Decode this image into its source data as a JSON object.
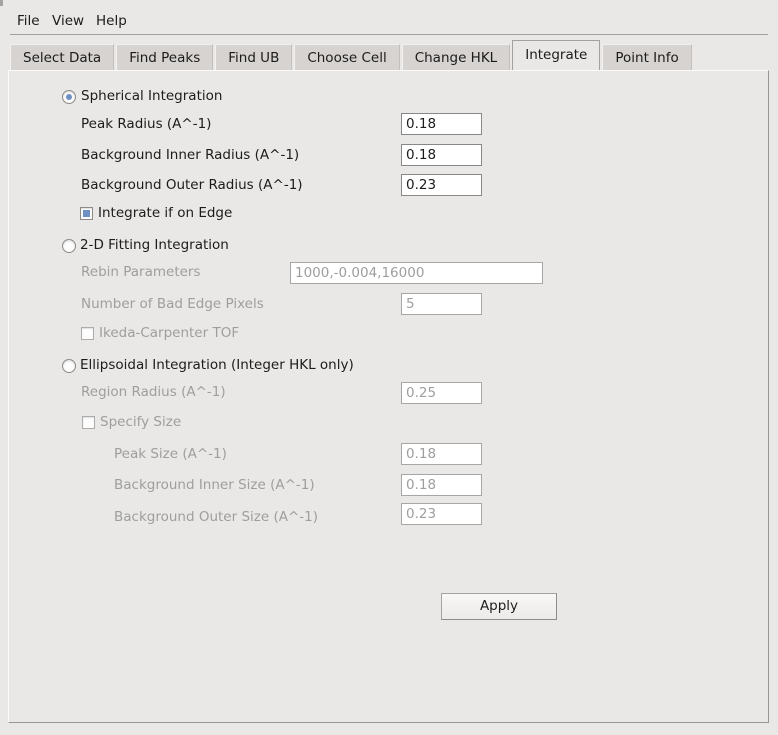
{
  "menu": {
    "items": [
      {
        "label": "File"
      },
      {
        "label": "View"
      },
      {
        "label": "Help"
      }
    ]
  },
  "tabs": {
    "items": [
      {
        "label": "Select Data",
        "selected": false
      },
      {
        "label": "Find Peaks",
        "selected": false
      },
      {
        "label": "Find UB",
        "selected": false
      },
      {
        "label": "Choose Cell",
        "selected": false
      },
      {
        "label": "Change HKL",
        "selected": false
      },
      {
        "label": "Integrate",
        "selected": true
      },
      {
        "label": "Point Info",
        "selected": false
      }
    ]
  },
  "panel": {
    "spherical": {
      "label": "Spherical Integration",
      "selected": true,
      "peak_radius": {
        "label": "Peak Radius (A^-1)",
        "value": "0.18"
      },
      "bg_inner_radius": {
        "label": "Background Inner Radius (A^-1)",
        "value": "0.18"
      },
      "bg_outer_radius": {
        "label": "Background Outer Radius (A^-1)",
        "value": "0.23"
      },
      "edge": {
        "label": "Integrate if on Edge",
        "checked": true
      }
    },
    "fit2d": {
      "label": "2-D Fitting Integration",
      "selected": false,
      "rebin": {
        "label": "Rebin Parameters",
        "value": "1000,-0.004,16000"
      },
      "bad_edge": {
        "label": "Number of Bad Edge Pixels",
        "value": "5"
      },
      "ikeda": {
        "label": "Ikeda-Carpenter TOF",
        "checked": false
      }
    },
    "ellipsoidal": {
      "label": "Ellipsoidal Integration (Integer HKL only)",
      "selected": false,
      "region_radius": {
        "label": "Region Radius (A^-1)",
        "value": "0.25"
      },
      "specify": {
        "label": "Specify Size",
        "checked": false
      },
      "peak_size": {
        "label": "Peak Size (A^-1)",
        "value": "0.18"
      },
      "bg_inner_size": {
        "label": "Background Inner Size (A^-1)",
        "value": "0.18"
      },
      "bg_outer_size": {
        "label": "Background Outer Size (A^-1)",
        "value": "0.23"
      }
    },
    "apply_label": "Apply"
  },
  "colors": {
    "background": "#e9e8e6",
    "tab_unselected": "#d6d3d0",
    "panel_border_shadow": "#989694",
    "text": "#1c1c1c",
    "disabled_text": "#9e9e9e",
    "accent_blue": "#6e90c2",
    "input_border": "#8a8886"
  }
}
